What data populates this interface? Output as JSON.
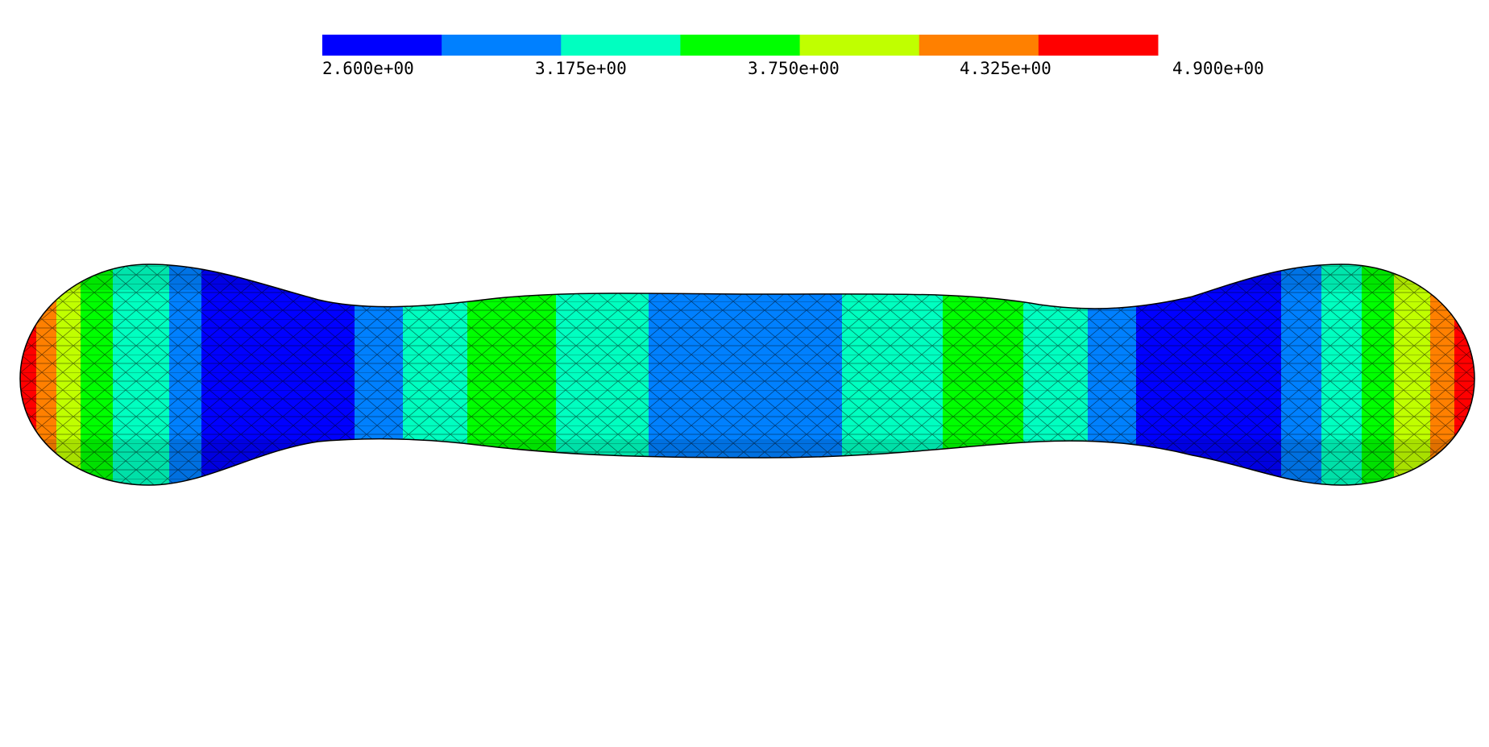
{
  "colorbar": {
    "min_value": 2.6,
    "max_value": 4.9,
    "colors": [
      "#0000ff",
      "#0080ff",
      "#00ffc0",
      "#00ff00",
      "#c0ff00",
      "#ff8000",
      "#ff0000"
    ],
    "tick_labels": [
      "2.600e+00",
      "3.175e+00",
      "3.750e+00",
      "4.325e+00",
      "4.900e+00"
    ]
  },
  "surface": {
    "description_colors": {
      "lowest": "#0000ff",
      "low": "#0080ff",
      "mid_low": "#00ffc0",
      "mid": "#00ff00",
      "mid_high": "#c0ff00",
      "high": "#ff8000",
      "highest": "#ff0000"
    },
    "mesh": "triangulated wireframe overlay"
  }
}
